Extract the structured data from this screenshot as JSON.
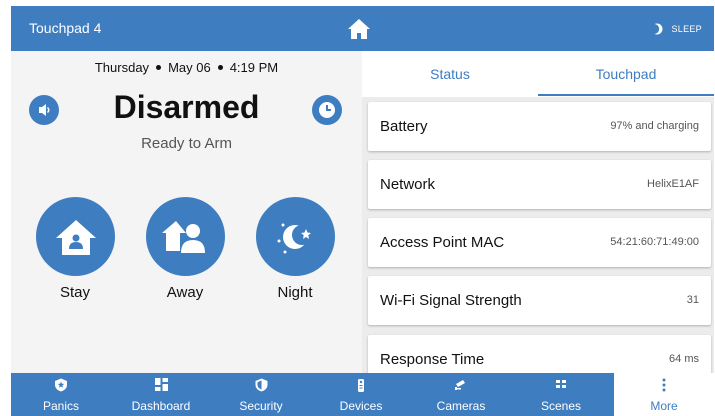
{
  "header": {
    "title": "Touchpad 4",
    "home_icon": "home-icon",
    "sleep_label": "SLEEP",
    "sleep_icon": "moon-icon"
  },
  "left": {
    "day": "Thursday",
    "date": "May 06",
    "time": "4:19 PM",
    "status": "Disarmed",
    "substatus": "Ready to Arm",
    "volume_icon": "speaker-icon",
    "clock_icon": "clock-icon",
    "modes": [
      {
        "label": "Stay",
        "icon": "stay-house-icon"
      },
      {
        "label": "Away",
        "icon": "away-people-icon"
      },
      {
        "label": "Night",
        "icon": "night-moon-icon"
      }
    ]
  },
  "tabs": {
    "status": "Status",
    "touchpad": "Touchpad",
    "active": "Touchpad"
  },
  "info": [
    {
      "label": "Battery",
      "value": "97% and charging"
    },
    {
      "label": "Network",
      "value": "HelixE1AF"
    },
    {
      "label": "Access Point MAC",
      "value": "54:21:60:71:49:00"
    },
    {
      "label": "Wi-Fi Signal Strength",
      "value": "31"
    },
    {
      "label": "Response Time",
      "value": "64 ms"
    }
  ],
  "nav": [
    {
      "label": "Panics",
      "icon": "shield-star-icon"
    },
    {
      "label": "Dashboard",
      "icon": "grid-icon"
    },
    {
      "label": "Security",
      "icon": "shield-icon"
    },
    {
      "label": "Devices",
      "icon": "remote-icon"
    },
    {
      "label": "Cameras",
      "icon": "camera-icon"
    },
    {
      "label": "Scenes",
      "icon": "scenes-icon"
    },
    {
      "label": "More",
      "icon": "more-icon",
      "active": true
    }
  ],
  "colors": {
    "accent": "#3e7dc0",
    "panel_left": "#f4f4f4",
    "panel_right": "#ececec"
  }
}
